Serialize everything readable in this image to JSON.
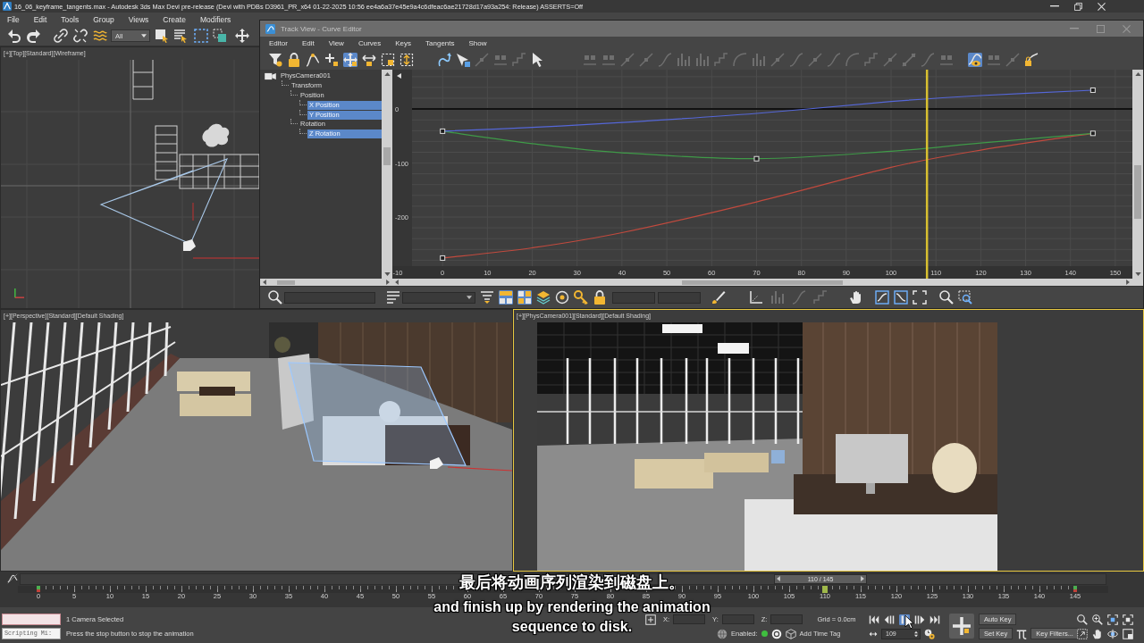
{
  "title_bar": {
    "title": "16_06_keyframe_tangents.max - Autodesk 3ds Max Devi pre-release (Devi with PDBs D3961_PR_x64 01-22-2025 10:56 ee4a6a37e45e9a4c6dfeac6ae21728d17a93a254: Release) ASSERTS=Off"
  },
  "menu": [
    "File",
    "Edit",
    "Tools",
    "Group",
    "Views",
    "Create",
    "Modifiers"
  ],
  "main_toolbar": {
    "selection_filter": "All"
  },
  "viewports": [
    {
      "kind": "top",
      "label": "[+][Top][Standard][Wireframe]",
      "active": false
    },
    {
      "kind": "perspective",
      "label": "[+][Perspective][Standard][Default Shading]",
      "active": false
    },
    {
      "kind": "camera",
      "label": "[+][PhysCamera001][Standard][Default Shading]",
      "active": true
    }
  ],
  "track_view": {
    "title": "Track View - Curve Editor",
    "menu": [
      "Editor",
      "Edit",
      "View",
      "Curves",
      "Keys",
      "Tangents",
      "Show"
    ],
    "tools": [
      {
        "selected": false,
        "disabled": false
      },
      {
        "selected": false,
        "disabled": false
      },
      {
        "selected": false,
        "disabled": false
      },
      {
        "selected": false,
        "disabled": false
      },
      {
        "selected": true,
        "disabled": false
      },
      {
        "selected": false,
        "disabled": false
      },
      {
        "selected": false,
        "disabled": false
      },
      {
        "selected": false,
        "disabled": false
      },
      {
        "selected": false,
        "disabled": false
      },
      {
        "selected": false,
        "disabled": false
      },
      {
        "selected": false,
        "disabled": true
      },
      {
        "selected": false,
        "disabled": true
      },
      {
        "selected": false,
        "disabled": true
      },
      {
        "selected": false,
        "disabled": false
      },
      {
        "selected": false,
        "disabled": true
      },
      {
        "selected": false,
        "disabled": true
      },
      {
        "selected": false,
        "disabled": true
      },
      {
        "selected": false,
        "disabled": true
      },
      {
        "selected": false,
        "disabled": true
      },
      {
        "selected": false,
        "disabled": true
      },
      {
        "selected": false,
        "disabled": true
      },
      {
        "selected": false,
        "disabled": true
      },
      {
        "selected": false,
        "disabled": true
      },
      {
        "selected": false,
        "disabled": true
      },
      {
        "selected": false,
        "disabled": true
      },
      {
        "selected": false,
        "disabled": true
      },
      {
        "selected": false,
        "disabled": true
      },
      {
        "selected": false,
        "disabled": true
      },
      {
        "selected": false,
        "disabled": true
      },
      {
        "selected": false,
        "disabled": true
      },
      {
        "selected": false,
        "disabled": true
      },
      {
        "selected": false,
        "disabled": true
      },
      {
        "selected": false,
        "disabled": true
      },
      {
        "selected": false,
        "disabled": true
      },
      {
        "selected": true,
        "disabled": false
      },
      {
        "selected": false,
        "disabled": true
      },
      {
        "selected": false,
        "disabled": true
      },
      {
        "selected": false,
        "disabled": false
      }
    ],
    "tree": [
      {
        "label": "PhysCamera001",
        "selected": false,
        "children": [
          {
            "label": "Transform",
            "selected": false,
            "children": [
              {
                "label": "Position",
                "selected": false,
                "children": [
                  {
                    "label": "X Position",
                    "selected": true
                  },
                  {
                    "label": "Y Position",
                    "selected": true
                  }
                ]
              },
              {
                "label": "Rotation",
                "selected": false,
                "children": [
                  {
                    "label": "Z Rotation",
                    "selected": true
                  }
                ]
              }
            ]
          }
        ]
      }
    ],
    "graph": {
      "chart_data": {
        "type": "line",
        "x": [
          0,
          20,
          40,
          70,
          100,
          120,
          145
        ],
        "series": [
          {
            "color": "#c24a3e",
            "values": [
              -276,
              -257,
              -229,
              -172,
              -108,
              -76,
              -45
            ]
          },
          {
            "color": "#3f9a48",
            "values": [
              -41,
              -64,
              -81,
              -92,
              -78,
              -63,
              -45
            ]
          },
          {
            "color": "#5567d8",
            "values": [
              -41,
              -34,
              -25,
              -8,
              14,
              25,
              35
            ]
          }
        ],
        "xlim": [
          -11.2,
          153.8
        ],
        "ylim": [
          -291,
          73
        ],
        "xticks": [
          -10,
          0,
          10,
          20,
          30,
          40,
          50,
          60,
          70,
          80,
          90,
          100,
          110,
          120,
          130,
          140,
          150
        ],
        "yticks": [
          0,
          -100,
          -200
        ],
        "grid": true,
        "ref_lines": [
          {
            "axis": "x",
            "value": 108
          }
        ]
      }
    },
    "bottom_tools": [
      {
        "selected": false,
        "disabled": false
      },
      {
        "selected": false,
        "disabled": false
      },
      {
        "selected": false,
        "disabled": false
      },
      {
        "selected": true,
        "disabled": false
      },
      {
        "selected": true,
        "disabled": false
      },
      {
        "selected": false,
        "disabled": false
      },
      {
        "selected": false,
        "disabled": false
      },
      {
        "selected": false,
        "disabled": false
      },
      {
        "selected": false,
        "disabled": false
      },
      {
        "selected": false,
        "disabled": false
      },
      {
        "selected": false,
        "disabled": false
      },
      {
        "selected": false,
        "disabled": true
      },
      {
        "selected": false,
        "disabled": true
      },
      {
        "selected": false,
        "disabled": true
      },
      {
        "selected": false,
        "disabled": false
      },
      {
        "selected": false,
        "disabled": false
      },
      {
        "selected": false,
        "disabled": false
      },
      {
        "selected": false,
        "disabled": false
      },
      {
        "selected": false,
        "disabled": false
      },
      {
        "selected": false,
        "disabled": false
      }
    ]
  },
  "time_slider": {
    "label": "110 / 145",
    "level": 0.759
  },
  "ruler": {
    "labels": [
      "0",
      "5",
      "10",
      "15",
      "20",
      "25",
      "30",
      "35",
      "40",
      "45",
      "50",
      "55",
      "60",
      "65",
      "70",
      "75",
      "80",
      "85",
      "90",
      "95",
      "100",
      "105",
      "110",
      "115",
      "120",
      "125",
      "130",
      "135",
      "140",
      "145"
    ],
    "key_marks": [
      {
        "level": 0
      },
      {
        "level": 1
      }
    ]
  },
  "status_bar": {
    "listener_prompt": "Scripting Mi:",
    "selection": "1 Camera Selected",
    "prompt": "Press the stop button to stop the animation",
    "coords": [
      "X:",
      "Y:",
      "Z:"
    ],
    "grid": "Grid = 0.0cm",
    "time_tag": {
      "label": "Enabled:",
      "enabled": true,
      "button": "Add Time Tag"
    },
    "transport": [
      {
        "selected": false
      },
      {
        "selected": false
      },
      {
        "selected": true
      },
      {
        "selected": false
      },
      {
        "selected": false
      }
    ],
    "frame": "109",
    "auto_key": "Auto Key",
    "set_key": "Set Key",
    "key_filters": "Key Filters..."
  },
  "subtitles": {
    "chinese": "最后将动画序列渲染到磁盘上。",
    "english": [
      "and finish up by rendering the animation",
      "sequence to disk."
    ]
  }
}
